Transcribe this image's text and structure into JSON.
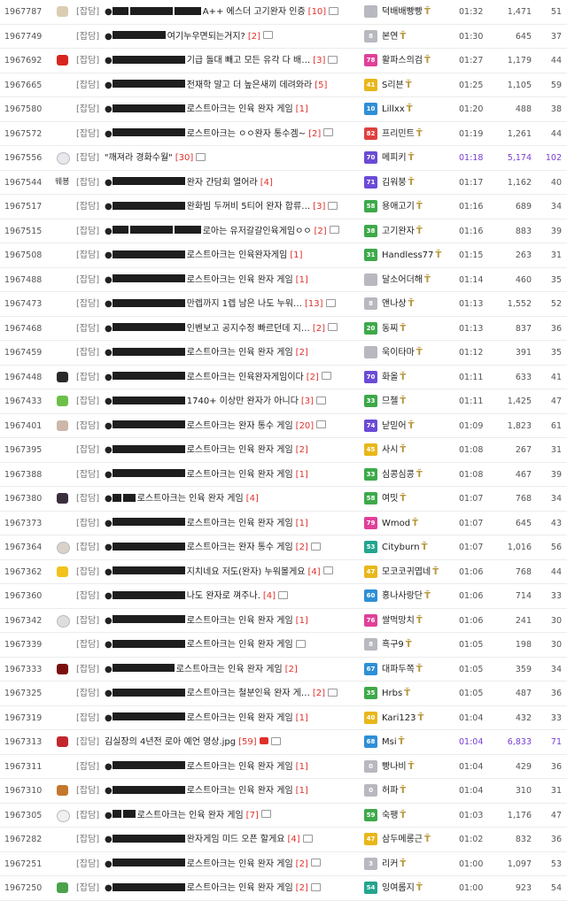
{
  "colors": {
    "level_gray": "#b8b8c0",
    "level_red": "#e04040",
    "level_orange": "#f08a1a",
    "level_yellow": "#e8b71a",
    "level_green": "#3ea94a",
    "level_teal": "#23a58f",
    "level_blue": "#2f8fd6",
    "level_purple": "#6b4bd6",
    "level_pink": "#e0409a",
    "highlight": "#7a3fd1",
    "comment_count": "#e0302b"
  },
  "rows": [
    {
      "id": "1967787",
      "head": "[잡담]",
      "emblem": "dog",
      "title": "A++ 에스더 고기완자 인증",
      "comments": "[10]",
      "img": true,
      "video": false,
      "level": "",
      "lvc": "gray",
      "nick": "덕배배빵빵",
      "time": "01:32",
      "views": "1,471",
      "rec": "51",
      "red": [
        18,
        48,
        30
      ]
    },
    {
      "id": "1967749",
      "head": "[잡담]",
      "emblem": "",
      "title": "여기누우면되는거지?",
      "comments": "[2]",
      "img": true,
      "video": false,
      "level": "8",
      "lvc": "gray",
      "nick": "본연",
      "time": "01:30",
      "views": "645",
      "rec": "37",
      "red": [
        60
      ]
    },
    {
      "id": "1967692",
      "head": "[잡담]",
      "emblem": "redflower",
      "title": "기급 돌대 빼고 모든 유각 다 배…",
      "comments": "[3]",
      "img": true,
      "video": false,
      "level": "78",
      "lvc": "pink",
      "nick": "활파스의검",
      "time": "01:27",
      "views": "1,179",
      "rec": "44",
      "red": [
        82
      ]
    },
    {
      "id": "1967665",
      "head": "[잡담]",
      "emblem": "",
      "title": "전재학 말고 더 높은새끼 데려와라",
      "comments": "[5]",
      "img": false,
      "video": false,
      "level": "41",
      "lvc": "yellow",
      "nick": "S리븐",
      "time": "01:25",
      "views": "1,105",
      "rec": "59",
      "red": [
        82
      ]
    },
    {
      "id": "1967580",
      "head": "[잡담]",
      "emblem": "",
      "title": "로스트아크는 인육 완자 게임",
      "comments": "[1]",
      "img": false,
      "video": false,
      "level": "10",
      "lvc": "blue",
      "nick": "Lillxx",
      "time": "01:20",
      "views": "488",
      "rec": "38",
      "red": [
        82
      ]
    },
    {
      "id": "1967572",
      "head": "[잡담]",
      "emblem": "",
      "title": "로스트아크는 ㅇㅇ완자 통수겜~",
      "comments": "[2]",
      "img": true,
      "video": false,
      "level": "82",
      "lvc": "red",
      "nick": "프리민트",
      "time": "01:19",
      "views": "1,261",
      "rec": "44",
      "red": [
        82
      ]
    },
    {
      "id": "1967556",
      "head": "[잡담]",
      "emblem": "bunny",
      "title": "\"깨져라 경화수월\"",
      "comments": "[30]",
      "img": true,
      "video": false,
      "level": "70",
      "lvc": "purple",
      "nick": "메피키",
      "time": "01:18",
      "views": "5,174",
      "rec": "102",
      "red": [],
      "hl": true,
      "nodot": true
    },
    {
      "id": "1967544",
      "head": "[잡담]",
      "emblem": "text",
      "embText": "웨뵹",
      "title": "완자 간담회 열어라",
      "comments": "[4]",
      "img": false,
      "video": false,
      "level": "71",
      "lvc": "purple",
      "nick": "김워붕",
      "time": "01:17",
      "views": "1,162",
      "rec": "40",
      "red": [
        82
      ]
    },
    {
      "id": "1967517",
      "head": "[잡담]",
      "emblem": "",
      "title": "완화빔 두꺼비 5티어 완자 합류…",
      "comments": "[3]",
      "img": true,
      "video": false,
      "level": "58",
      "lvc": "green",
      "nick": "용애고기",
      "time": "01:16",
      "views": "689",
      "rec": "34",
      "red": [
        82
      ]
    },
    {
      "id": "1967515",
      "head": "[잡담]",
      "emblem": "",
      "title": "로아는 유저갈갈인육게임ㅇㅇ",
      "comments": "[2]",
      "img": true,
      "video": false,
      "level": "38",
      "lvc": "green",
      "nick": "고기완자",
      "time": "01:16",
      "views": "883",
      "rec": "39",
      "red": [
        18,
        48,
        30
      ]
    },
    {
      "id": "1967508",
      "head": "[잡담]",
      "emblem": "",
      "title": "로스트아크는 인육완자게임",
      "comments": "[1]",
      "img": false,
      "video": false,
      "level": "31",
      "lvc": "green",
      "nick": "Handless77",
      "time": "01:15",
      "views": "263",
      "rec": "31",
      "red": [
        82
      ]
    },
    {
      "id": "1967488",
      "head": "[잡담]",
      "emblem": "",
      "title": "로스트아크는 인육 완자 게임",
      "comments": "[1]",
      "img": false,
      "video": false,
      "level": "",
      "lvc": "gray",
      "nick": "달소어더해",
      "time": "01:14",
      "views": "460",
      "rec": "35",
      "red": [
        82
      ]
    },
    {
      "id": "1967473",
      "head": "[잡담]",
      "emblem": "",
      "title": "만렙까지 1렙 남은 나도 누워…",
      "comments": "[13]",
      "img": true,
      "video": false,
      "level": "8",
      "lvc": "gray",
      "nick": "앤나상",
      "time": "01:13",
      "views": "1,552",
      "rec": "52",
      "red": [
        82
      ]
    },
    {
      "id": "1967468",
      "head": "[잡담]",
      "emblem": "",
      "title": "인벤보고 공지수정 빠르던데 지…",
      "comments": "[2]",
      "img": true,
      "video": false,
      "level": "20",
      "lvc": "green",
      "nick": "동찌",
      "time": "01:13",
      "views": "837",
      "rec": "36",
      "red": [
        82
      ]
    },
    {
      "id": "1967459",
      "head": "[잡담]",
      "emblem": "",
      "title": "로스트아크는 인육 완자 게임",
      "comments": "[2]",
      "img": false,
      "video": false,
      "level": "",
      "lvc": "gray",
      "nick": "욱이타마",
      "time": "01:12",
      "views": "391",
      "rec": "35",
      "red": [
        82
      ]
    },
    {
      "id": "1967448",
      "head": "[잡담]",
      "emblem": "darkcircle",
      "title": "로스트아크는 인육완자게임이다",
      "comments": "[2]",
      "img": true,
      "video": false,
      "level": "70",
      "lvc": "purple",
      "nick": "화올",
      "time": "01:11",
      "views": "633",
      "rec": "41",
      "red": [
        82
      ]
    },
    {
      "id": "1967433",
      "head": "[잡담]",
      "emblem": "greenface",
      "title": "1740+ 이상만 완자가 아니다",
      "comments": "[3]",
      "img": true,
      "video": false,
      "level": "33",
      "lvc": "green",
      "nick": "므첼",
      "time": "01:11",
      "views": "1,425",
      "rec": "47",
      "red": [
        82
      ]
    },
    {
      "id": "1967401",
      "head": "[잡담]",
      "emblem": "photo",
      "title": "로스트아크는 완자 통수 게임",
      "comments": "[20]",
      "img": true,
      "video": false,
      "level": "74",
      "lvc": "purple",
      "nick": "낟믿어",
      "time": "01:09",
      "views": "1,823",
      "rec": "61",
      "red": [
        82
      ]
    },
    {
      "id": "1967395",
      "head": "[잡담]",
      "emblem": "",
      "title": "로스트아크는 인육 완자 게임",
      "comments": "[2]",
      "img": false,
      "video": false,
      "level": "45",
      "lvc": "yellow",
      "nick": "사시",
      "time": "01:08",
      "views": "267",
      "rec": "31",
      "red": [
        82
      ]
    },
    {
      "id": "1967388",
      "head": "[잡담]",
      "emblem": "",
      "title": "로스트아크는 인육 완자 게임",
      "comments": "[1]",
      "img": false,
      "video": false,
      "level": "33",
      "lvc": "green",
      "nick": "심콩심콩",
      "time": "01:08",
      "views": "467",
      "rec": "39",
      "red": [
        82
      ]
    },
    {
      "id": "1967380",
      "head": "[잡담]",
      "emblem": "kuromi",
      "title": "로스트아크는 인육 완자 게임",
      "comments": "[4]",
      "img": false,
      "video": false,
      "level": "58",
      "lvc": "green",
      "nick": "여밋",
      "time": "01:07",
      "views": "768",
      "rec": "34",
      "red": [
        10,
        14
      ]
    },
    {
      "id": "1967373",
      "head": "[잡담]",
      "emblem": "",
      "title": "로스트아크는 인육 완자 게임",
      "comments": "[1]",
      "img": false,
      "video": false,
      "level": "79",
      "lvc": "pink",
      "nick": "Wmod",
      "time": "01:07",
      "views": "645",
      "rec": "43",
      "red": [
        82
      ]
    },
    {
      "id": "1967364",
      "head": "[잡담]",
      "emblem": "sheep",
      "title": "로스트아크는 완자 통수 게임",
      "comments": "[2]",
      "img": true,
      "video": false,
      "level": "53",
      "lvc": "teal",
      "nick": "Cityburn",
      "time": "01:07",
      "views": "1,016",
      "rec": "56",
      "red": [
        82
      ]
    },
    {
      "id": "1967362",
      "head": "[잡담]",
      "emblem": "key",
      "title": "지치네요 저도(완자) 누워볼게요",
      "comments": "[4]",
      "img": true,
      "video": false,
      "level": "47",
      "lvc": "yellow",
      "nick": "모코코귀엽네",
      "time": "01:06",
      "views": "768",
      "rec": "44",
      "red": [
        82
      ]
    },
    {
      "id": "1967360",
      "head": "[잡담]",
      "emblem": "",
      "title": "나도 완자로 껴주나.",
      "comments": "[4]",
      "img": true,
      "video": false,
      "level": "60",
      "lvc": "blue",
      "nick": "홍나사랑단",
      "time": "01:06",
      "views": "714",
      "rec": "33",
      "red": [
        82
      ]
    },
    {
      "id": "1967342",
      "head": "[잡담]",
      "emblem": "panda",
      "title": "로스트아크는 인육 완자 게임",
      "comments": "[1]",
      "img": false,
      "video": false,
      "level": "76",
      "lvc": "pink",
      "nick": "쌀먹망치",
      "time": "01:06",
      "views": "241",
      "rec": "30",
      "red": [
        82
      ]
    },
    {
      "id": "1967339",
      "head": "[잡담]",
      "emblem": "",
      "title": "로스트아크는 인육 완자 게임",
      "comments": "",
      "img": true,
      "video": false,
      "level": "8",
      "lvc": "gray",
      "nick": "흑구9",
      "time": "01:05",
      "views": "198",
      "rec": "30",
      "red": [
        82
      ]
    },
    {
      "id": "1967333",
      "head": "[잡담]",
      "emblem": "redcard",
      "title": "로스트아크는 인육 완자 게임",
      "comments": "[2]",
      "img": false,
      "video": false,
      "level": "67",
      "lvc": "blue",
      "nick": "대파두쪽",
      "time": "01:05",
      "views": "359",
      "rec": "34",
      "red": [
        70
      ]
    },
    {
      "id": "1967325",
      "head": "[잡담]",
      "emblem": "",
      "title": "로스트아크는 철분인육 완자 게…",
      "comments": "[2]",
      "img": true,
      "video": false,
      "level": "35",
      "lvc": "green",
      "nick": "Hrbs",
      "time": "01:05",
      "views": "487",
      "rec": "36",
      "red": [
        82
      ]
    },
    {
      "id": "1967319",
      "head": "[잡담]",
      "emblem": "",
      "title": "로스트아크는 인육 완자 게임",
      "comments": "[1]",
      "img": false,
      "video": false,
      "level": "40",
      "lvc": "yellow",
      "nick": "Kari123",
      "time": "01:04",
      "views": "432",
      "rec": "33",
      "red": [
        82
      ]
    },
    {
      "id": "1967313",
      "head": "[잡담]",
      "emblem": "shield",
      "title": "김실장의 4년전 로아 예언 영상.jpg",
      "comments": "[59]",
      "img": true,
      "video": true,
      "level": "68",
      "lvc": "blue",
      "nick": "Msi",
      "time": "01:04",
      "views": "6,833",
      "rec": "71",
      "red": [],
      "hl": true,
      "nodot": true
    },
    {
      "id": "1967311",
      "head": "[잡담]",
      "emblem": "",
      "title": "로스트아크는 인육 완자 게임",
      "comments": "[1]",
      "img": false,
      "video": false,
      "level": "0",
      "lvc": "gray",
      "nick": "빵나비",
      "time": "01:04",
      "views": "429",
      "rec": "36",
      "red": [
        82
      ]
    },
    {
      "id": "1967310",
      "head": "[잡담]",
      "emblem": "chipmunk",
      "title": "로스트아크는 인육 완자 게임",
      "comments": "[1]",
      "img": false,
      "video": false,
      "level": "0",
      "lvc": "gray",
      "nick": "허파",
      "time": "01:04",
      "views": "310",
      "rec": "31",
      "red": [
        82
      ]
    },
    {
      "id": "1967305",
      "head": "[잡담]",
      "emblem": "eyes",
      "title": "로스트아크는 인육 완자 게임",
      "comments": "[7]",
      "img": true,
      "video": false,
      "level": "59",
      "lvc": "green",
      "nick": "숙팽",
      "time": "01:03",
      "views": "1,176",
      "rec": "47",
      "red": [
        10,
        14
      ]
    },
    {
      "id": "1967282",
      "head": "[잡담]",
      "emblem": "",
      "title": "완자게임 미드 오픈 할게요",
      "comments": "[4]",
      "img": true,
      "video": false,
      "level": "47",
      "lvc": "yellow",
      "nick": "삼두메롱근",
      "time": "01:02",
      "views": "832",
      "rec": "36",
      "red": [
        82
      ]
    },
    {
      "id": "1967251",
      "head": "[잡담]",
      "emblem": "",
      "title": "로스트아크는 인육 완자 게임",
      "comments": "[2]",
      "img": true,
      "video": false,
      "level": "3",
      "lvc": "gray",
      "nick": "리커",
      "time": "01:00",
      "views": "1,097",
      "rec": "53",
      "red": [
        82
      ]
    },
    {
      "id": "1967250",
      "head": "[잡담]",
      "emblem": "greenshield",
      "title": "로스트아크는 인육 완자 게임",
      "comments": "[2]",
      "img": true,
      "video": false,
      "level": "54",
      "lvc": "teal",
      "nick": "잉여롬지",
      "time": "01:00",
      "views": "923",
      "rec": "54",
      "red": [
        82
      ]
    }
  ]
}
